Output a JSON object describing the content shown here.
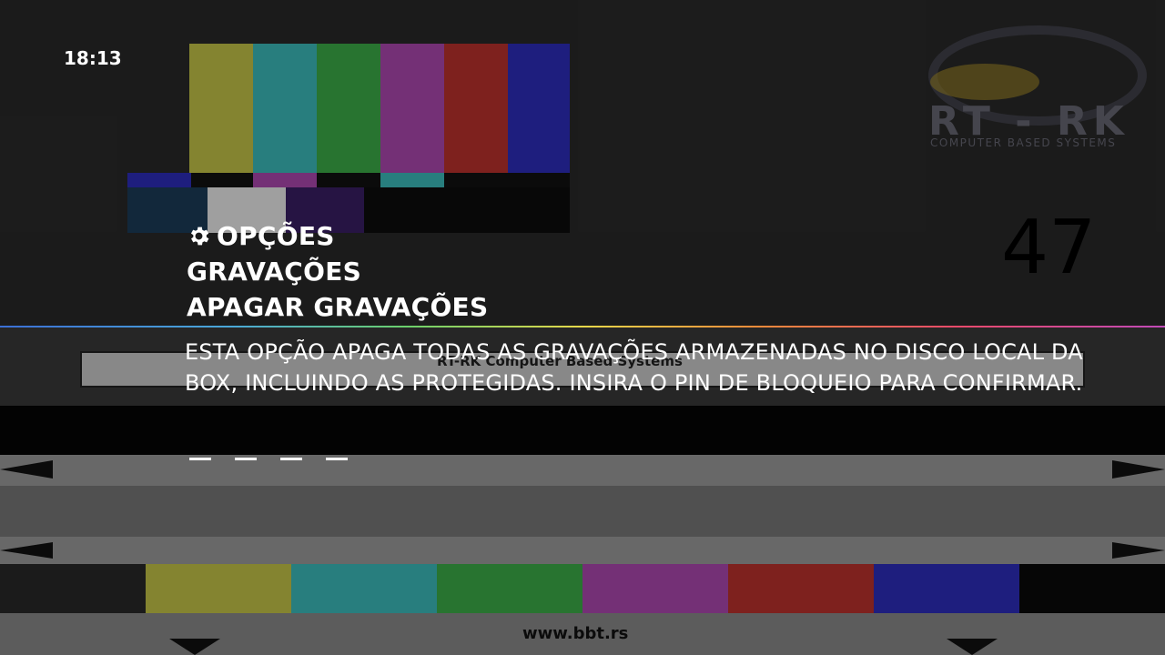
{
  "clock": {
    "time": "18:13"
  },
  "breadcrumb": {
    "level1": "OPÇÕES",
    "level2": "GRAVAÇÕES",
    "level3": "APAGAR GRAVAÇÕES"
  },
  "description": "ESTA OPÇÃO APAGA TODAS AS GRAVAÇÕES ARMAZENADAS NO DISCO LOCAL DA BOX, INCLUINDO AS PROTEGIDAS. INSIRA O PIN DE BLOQUEIO PARA CONFIRMAR.",
  "pin": {
    "length": 4,
    "entered": 0
  },
  "background": {
    "logo_text": "RT - RK",
    "logo_subtext": "COMPUTER BASED SYSTEMS",
    "channel_number": "47",
    "url": "www.bbt.rs",
    "company": "RT-RK Computer Based Systems"
  },
  "icons": {
    "options": "gear-icon"
  }
}
